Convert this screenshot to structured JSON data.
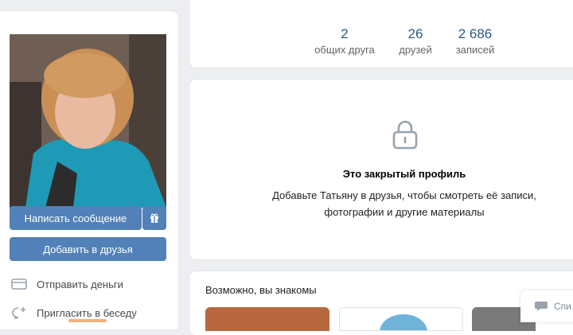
{
  "profile": {
    "write_message": "Написать сообщение",
    "add_friend": "Добавить в друзья",
    "actions": [
      {
        "label": "Отправить деньги",
        "icon": "card-icon"
      },
      {
        "label": "Пригласить в беседу",
        "icon": "add-chat-icon"
      }
    ]
  },
  "stats": [
    {
      "num": "2",
      "label": "общих друга"
    },
    {
      "num": "26",
      "label": "друзей"
    },
    {
      "num": "2 686",
      "label": "записей"
    }
  ],
  "closed": {
    "title": "Это закрытый профиль",
    "line1": "Добавьте Татьяну в друзья, чтобы смотреть её записи,",
    "line2": "фотографии и другие материалы"
  },
  "maybe": {
    "title": "Возможно, вы знакомы"
  },
  "chat": {
    "label": "Спи"
  },
  "colors": {
    "accent": "#5181b8",
    "link": "#2a5885",
    "background": "#edeef0"
  }
}
